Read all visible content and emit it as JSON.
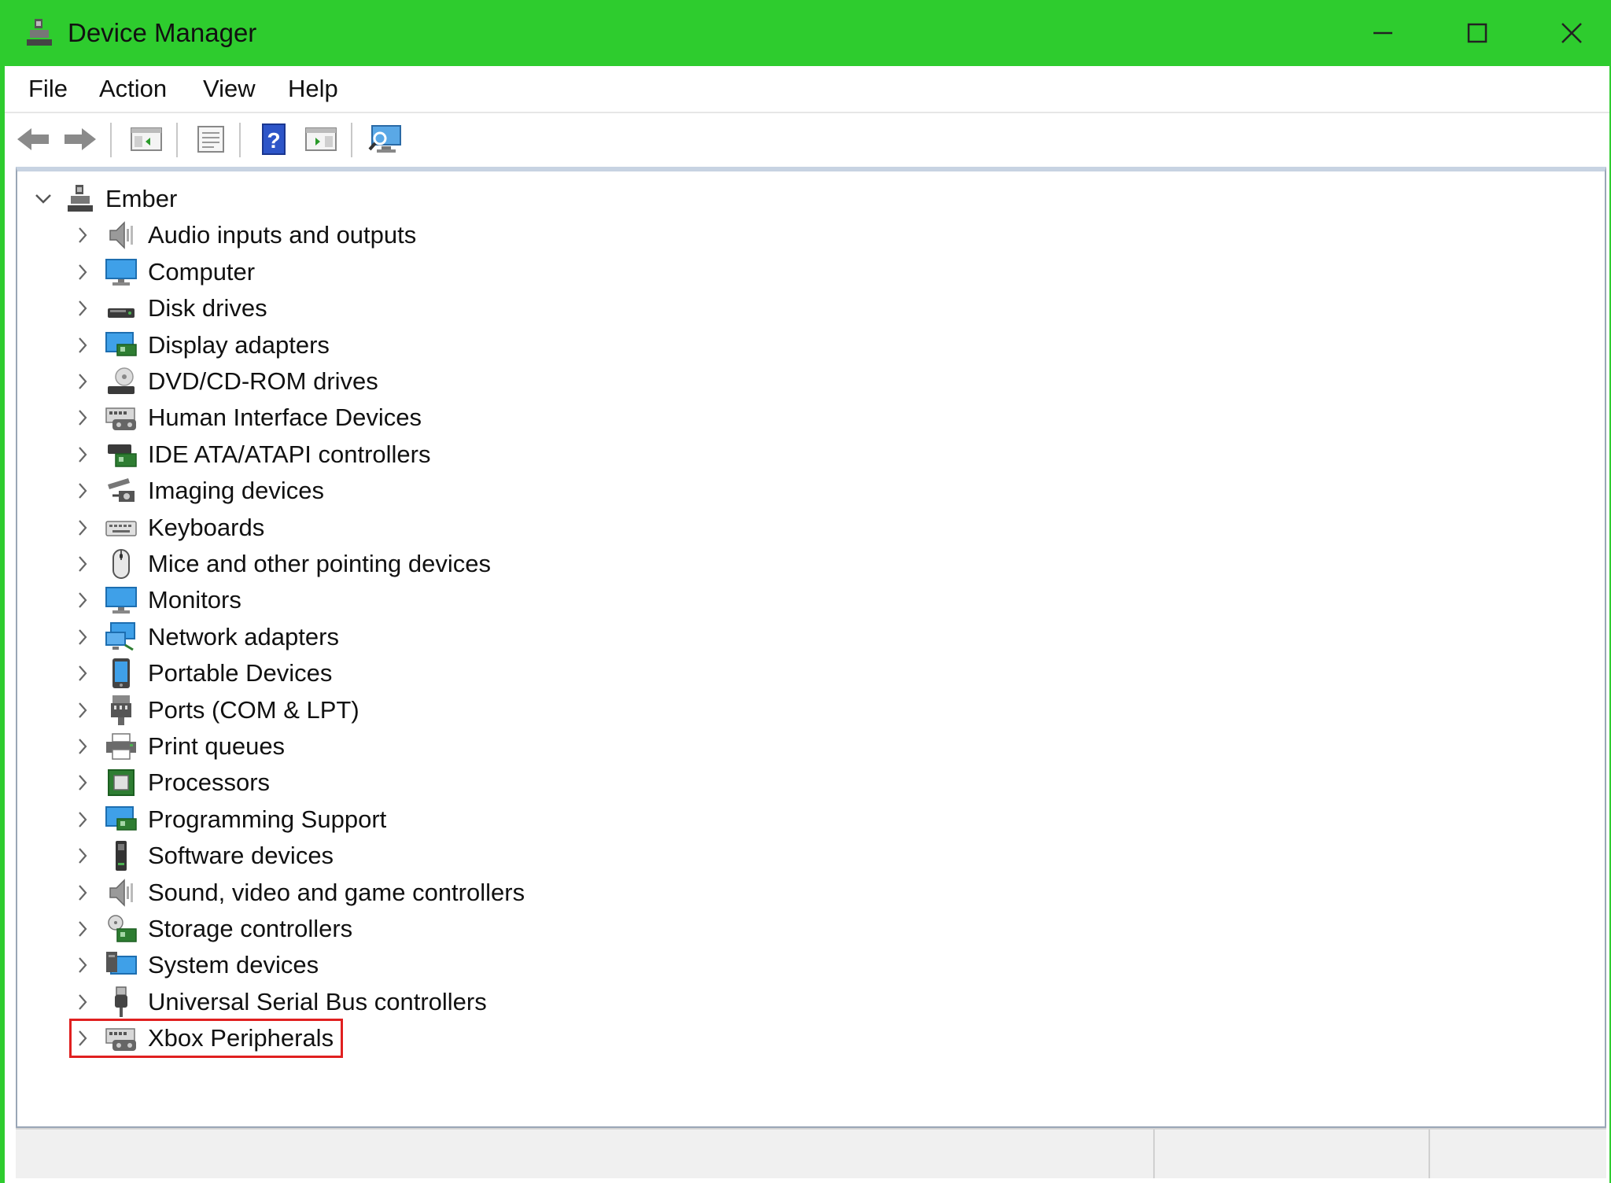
{
  "window": {
    "title": "Device Manager",
    "accent_color": "#2ecc2e",
    "title_icon": "device-manager-icon"
  },
  "menu": {
    "items": [
      {
        "label": "File"
      },
      {
        "label": "Action"
      },
      {
        "label": "View"
      },
      {
        "label": "Help"
      }
    ]
  },
  "toolbar": {
    "buttons": [
      {
        "icon": "back-arrow-icon"
      },
      {
        "icon": "forward-arrow-icon"
      },
      {
        "icon": "show-hide-console-tree-icon"
      },
      {
        "icon": "properties-icon"
      },
      {
        "icon": "help-icon"
      },
      {
        "icon": "action-pane-icon"
      },
      {
        "icon": "scan-hardware-changes-icon"
      }
    ]
  },
  "tree": {
    "root": {
      "label": "Ember",
      "expanded": true,
      "icon": "computer-tree-icon"
    },
    "children": [
      {
        "label": "Audio inputs and outputs",
        "icon": "speaker-icon"
      },
      {
        "label": "Computer",
        "icon": "monitor-icon"
      },
      {
        "label": "Disk drives",
        "icon": "disk-drive-icon"
      },
      {
        "label": "Display adapters",
        "icon": "display-adapter-icon"
      },
      {
        "label": "DVD/CD-ROM drives",
        "icon": "dvd-drive-icon"
      },
      {
        "label": "Human Interface Devices",
        "icon": "hid-icon"
      },
      {
        "label": "IDE ATA/ATAPI controllers",
        "icon": "ide-controller-icon"
      },
      {
        "label": "Imaging devices",
        "icon": "camera-icon"
      },
      {
        "label": "Keyboards",
        "icon": "keyboard-icon"
      },
      {
        "label": "Mice and other pointing devices",
        "icon": "mouse-icon"
      },
      {
        "label": "Monitors",
        "icon": "monitor-icon"
      },
      {
        "label": "Network adapters",
        "icon": "network-adapter-icon"
      },
      {
        "label": "Portable Devices",
        "icon": "portable-device-icon"
      },
      {
        "label": "Ports (COM & LPT)",
        "icon": "port-icon"
      },
      {
        "label": "Print queues",
        "icon": "printer-icon"
      },
      {
        "label": "Processors",
        "icon": "processor-icon"
      },
      {
        "label": "Programming Support",
        "icon": "display-adapter-icon"
      },
      {
        "label": "Software devices",
        "icon": "software-device-icon"
      },
      {
        "label": "Sound, video and game controllers",
        "icon": "speaker-icon"
      },
      {
        "label": "Storage controllers",
        "icon": "storage-controller-icon"
      },
      {
        "label": "System devices",
        "icon": "system-device-icon"
      },
      {
        "label": "Universal Serial Bus controllers",
        "icon": "usb-icon"
      },
      {
        "label": "Xbox Peripherals",
        "icon": "hid-icon",
        "highlighted": true
      }
    ]
  },
  "highlight_color": "#e02020"
}
